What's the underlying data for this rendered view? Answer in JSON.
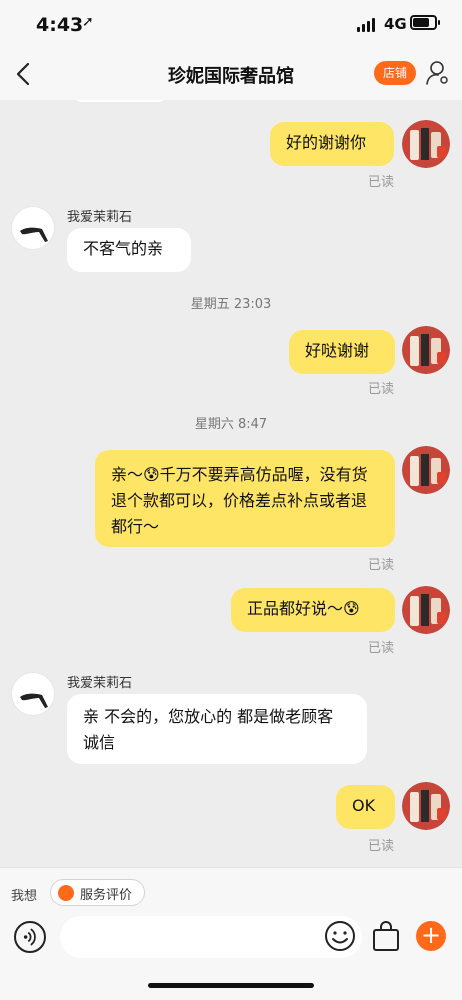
{
  "status_bar": {
    "time": "4:43",
    "location_icon": "location-arrow-icon",
    "network": "4G"
  },
  "nav": {
    "title": "珍妮国际奢品馆",
    "shop_button": "店铺",
    "back_icon": "chevron-left-icon",
    "user_icon": "user-settings-icon"
  },
  "shop": {
    "nickname": "我爱茉莉石"
  },
  "messages": [
    {
      "text": "好的谢谢你",
      "status": "已读"
    },
    {
      "text": "不客气的亲"
    },
    {
      "timestamp": "星期五 23:03"
    },
    {
      "text": "好哒谢谢",
      "status": "已读"
    },
    {
      "timestamp": "星期六 8:47"
    },
    {
      "text": "亲～😰千万不要弄高仿品喔，没有货退个款都可以，价格差点补点或者退都行～",
      "status": "已读"
    },
    {
      "text": "正品都好说～😰",
      "status": "已读"
    },
    {
      "text": "亲 不会的，您放心的 都是做老顾客 诚信"
    },
    {
      "text": "OK",
      "status": "已读"
    }
  ],
  "bottom_bar": {
    "think_label": "我想",
    "service_chip": "服务评价",
    "input_value": ""
  },
  "colors": {
    "accent": "#ff6a1a",
    "bubble_out": "#ffe566",
    "bubble_in": "#ffffff",
    "background": "#ededed"
  }
}
